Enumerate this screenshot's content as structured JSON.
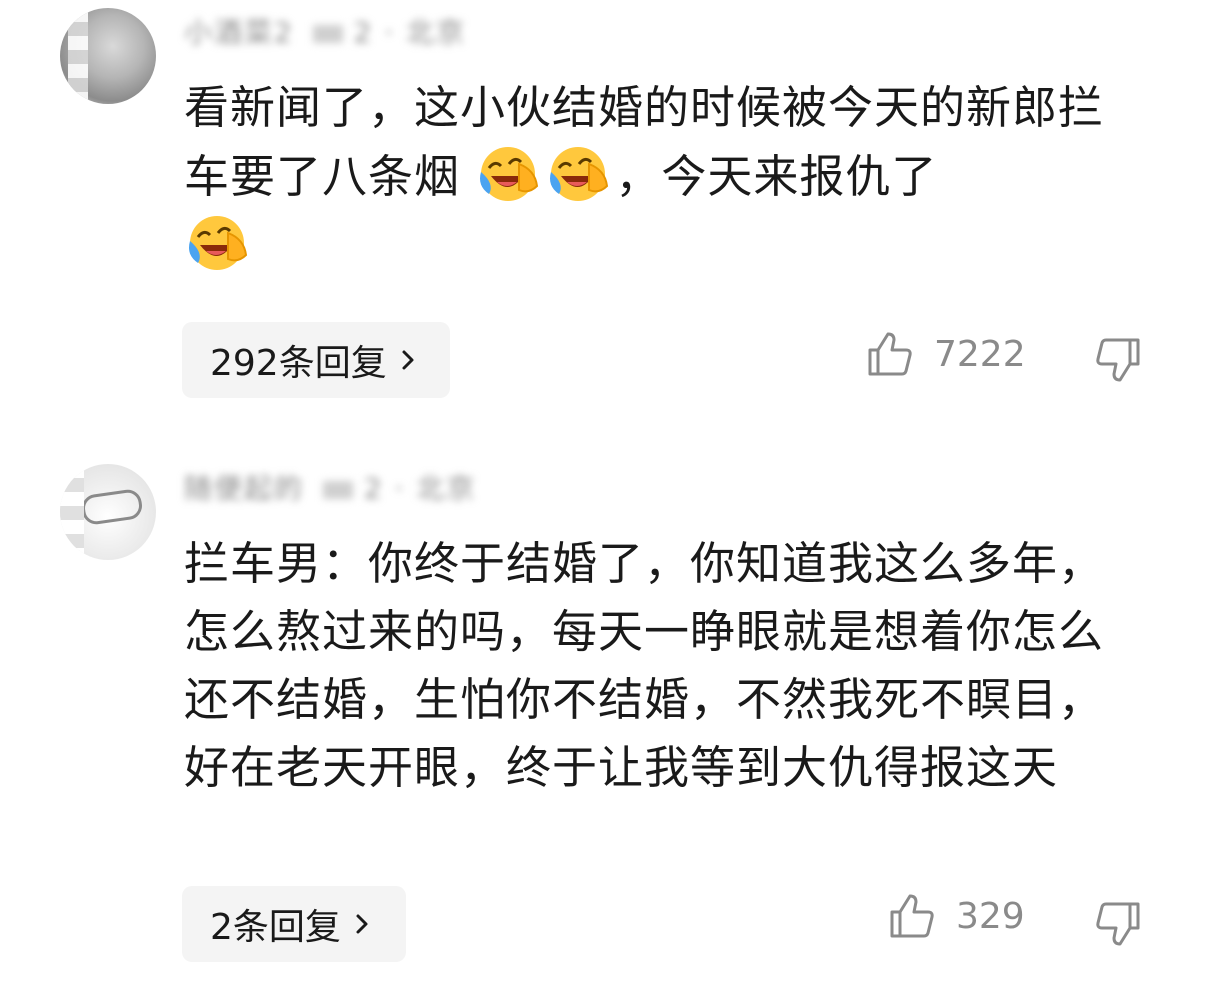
{
  "comments": [
    {
      "username": "小酒菜2",
      "meta": "2 · 北京",
      "text_line": "看新闻了，这小伙结婚的时候被今天的新郎拦车要了八条烟",
      "text_tail": "，今天来报仇了",
      "reply_label": "292条回复",
      "likes": "7222"
    },
    {
      "username": "随便起的",
      "meta": "2 · 北京",
      "text": "拦车男：你终于结婚了，你知道我这么多年，怎么熬过来的吗，每天一睁眼就是想着你怎么还不结婚，生怕你不结婚，不然我死不瞑目，好在老天开眼，终于让我等到大仇得报这天",
      "reply_label": "2条回复",
      "likes": "329"
    }
  ],
  "icons": {
    "emoji": "laugh-cry-emoji-icon",
    "like": "thumbs-up-icon",
    "dislike": "thumbs-down-icon",
    "chevron": "chevron-right-icon"
  },
  "colors": {
    "reply_bg": "#f4f4f4",
    "meta_gray": "#8a8a8a",
    "emoji_yellow": "#ffc83d",
    "emoji_tear": "#4aa3f0"
  }
}
